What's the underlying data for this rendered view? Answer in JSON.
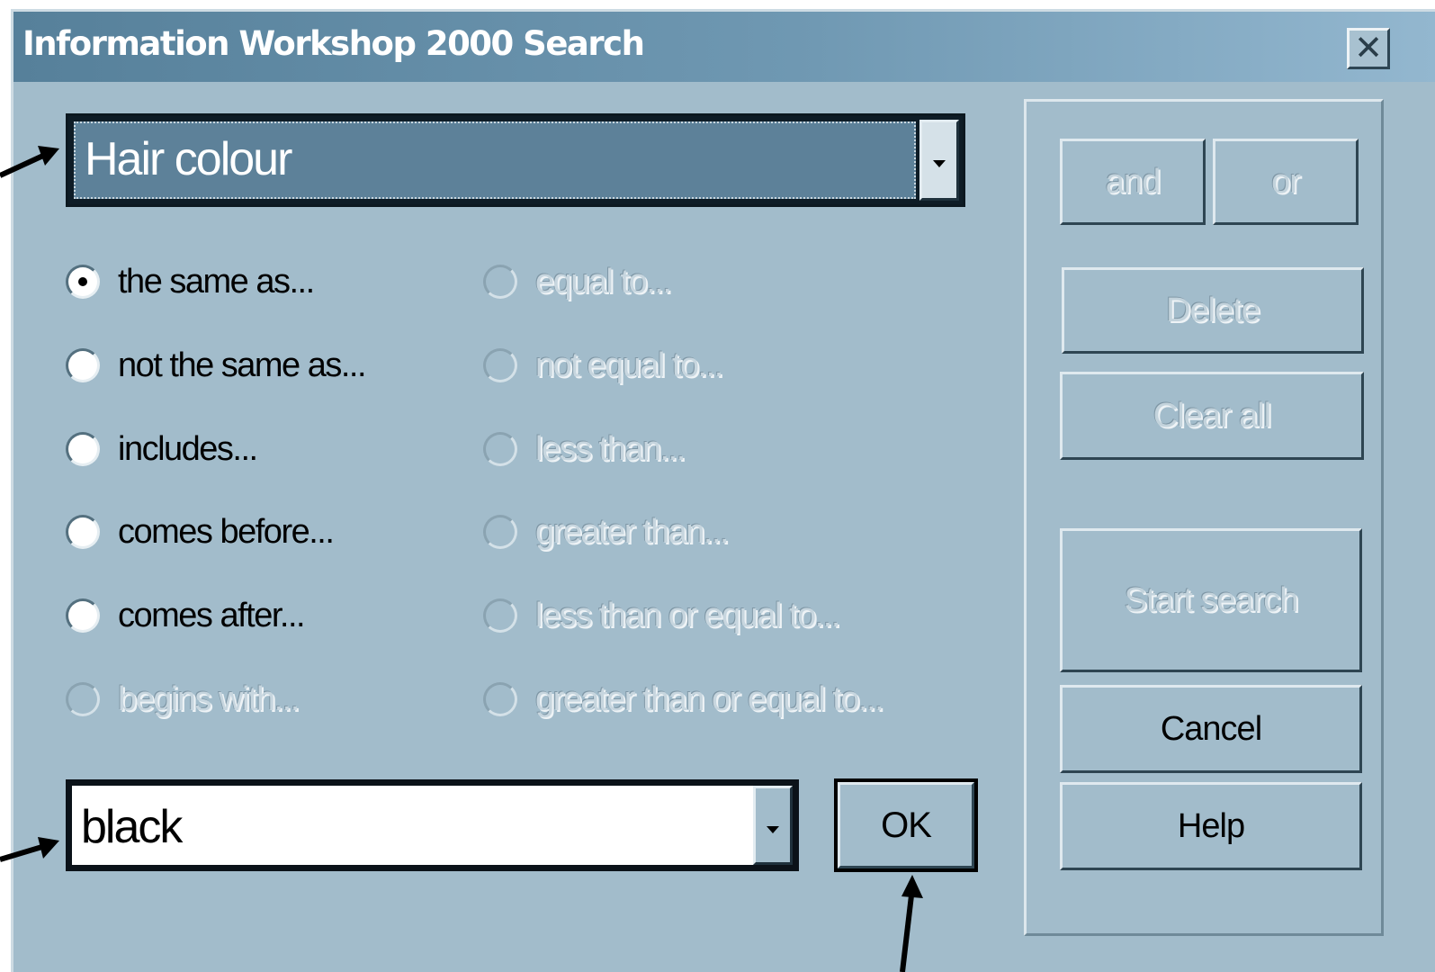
{
  "window": {
    "title": "Information Workshop 2000 Search",
    "close_icon": "close-icon"
  },
  "field_selector": {
    "selected": "Hair colour",
    "dropdown_icon": "dropdown-arrow-icon"
  },
  "operators_left": [
    {
      "label": "the same as...",
      "selected": true,
      "enabled": true
    },
    {
      "label": "not the same as...",
      "selected": false,
      "enabled": true
    },
    {
      "label": "includes...",
      "selected": false,
      "enabled": true
    },
    {
      "label": "comes before...",
      "selected": false,
      "enabled": true
    },
    {
      "label": "comes after...",
      "selected": false,
      "enabled": true
    },
    {
      "label": "begins with...",
      "selected": false,
      "enabled": false
    }
  ],
  "operators_right": [
    {
      "label": "equal to...",
      "selected": false,
      "enabled": false
    },
    {
      "label": "not equal to...",
      "selected": false,
      "enabled": false
    },
    {
      "label": "less than...",
      "selected": false,
      "enabled": false
    },
    {
      "label": "greater than...",
      "selected": false,
      "enabled": false
    },
    {
      "label": "less than or equal to...",
      "selected": false,
      "enabled": false
    },
    {
      "label": "greater than or equal to...",
      "selected": false,
      "enabled": false
    }
  ],
  "value_field": {
    "value": "black"
  },
  "buttons": {
    "ok": "OK",
    "and": "and",
    "or": "or",
    "delete": "Delete",
    "clear_all": "Clear all",
    "start_search": "Start search",
    "cancel": "Cancel",
    "help": "Help"
  },
  "colors": {
    "dialog_bg": "#a2bccb",
    "titlebar_start": "#56809a",
    "titlebar_end": "#93b7cf",
    "selection_bg": "#5d8199"
  }
}
